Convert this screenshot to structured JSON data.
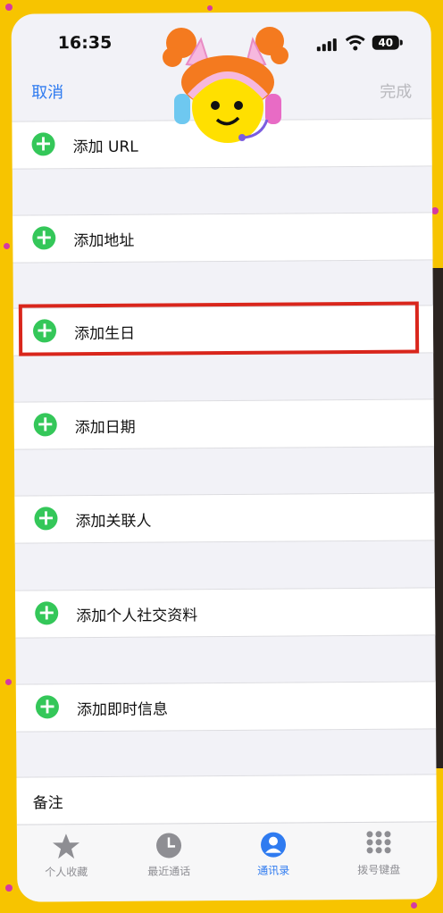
{
  "status_bar": {
    "time": "16:35",
    "battery": "40"
  },
  "nav": {
    "cancel": "取消",
    "done": "完成"
  },
  "rows": [
    {
      "label": "添加 URL"
    },
    {
      "label": "添加地址"
    },
    {
      "label": "添加生日"
    },
    {
      "label": "添加日期"
    },
    {
      "label": "添加关联人"
    },
    {
      "label": "添加个人社交资料"
    },
    {
      "label": "添加即时信息"
    }
  ],
  "notes": {
    "label": "备注"
  },
  "tabbar": {
    "tabs": [
      {
        "label": "个人收藏",
        "icon": "star-icon"
      },
      {
        "label": "最近通话",
        "icon": "clock-icon"
      },
      {
        "label": "通讯录",
        "icon": "contact-icon",
        "active": true
      },
      {
        "label": "拨号键盘",
        "icon": "keypad-icon"
      }
    ]
  },
  "colors": {
    "accent": "#2f7bf0",
    "plus": "#34c759",
    "highlight": "#d9261c",
    "frame": "#f7c400"
  }
}
